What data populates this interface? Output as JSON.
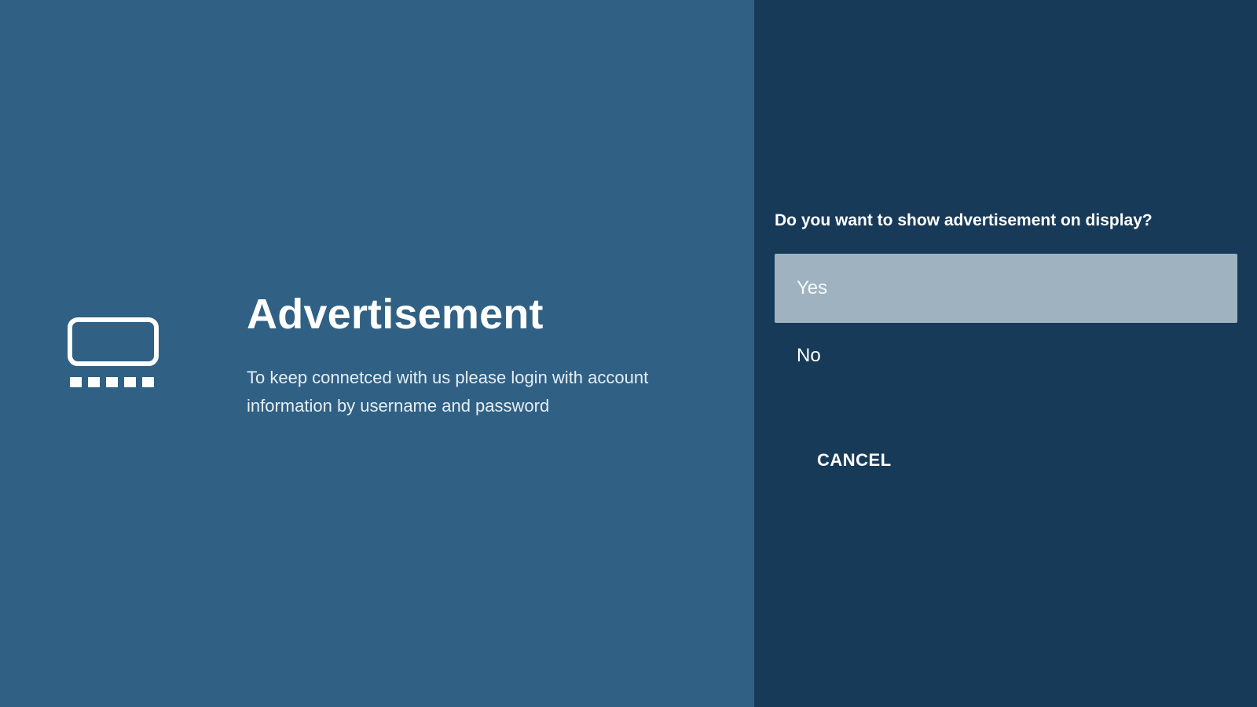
{
  "left_panel": {
    "icon": "display-screen-icon",
    "title": "Advertisement",
    "description": "To keep connetced with us please login with account information by username and password"
  },
  "dialog": {
    "question": "Do you want to show advertisement on display?",
    "options": [
      {
        "label": "Yes",
        "selected": true
      },
      {
        "label": "No",
        "selected": false
      }
    ],
    "cancel_label": "CANCEL"
  },
  "colors": {
    "left_background": "#306083",
    "right_background": "#183a59",
    "selected_option": "#9fb2bf",
    "text": "#ffffff"
  }
}
